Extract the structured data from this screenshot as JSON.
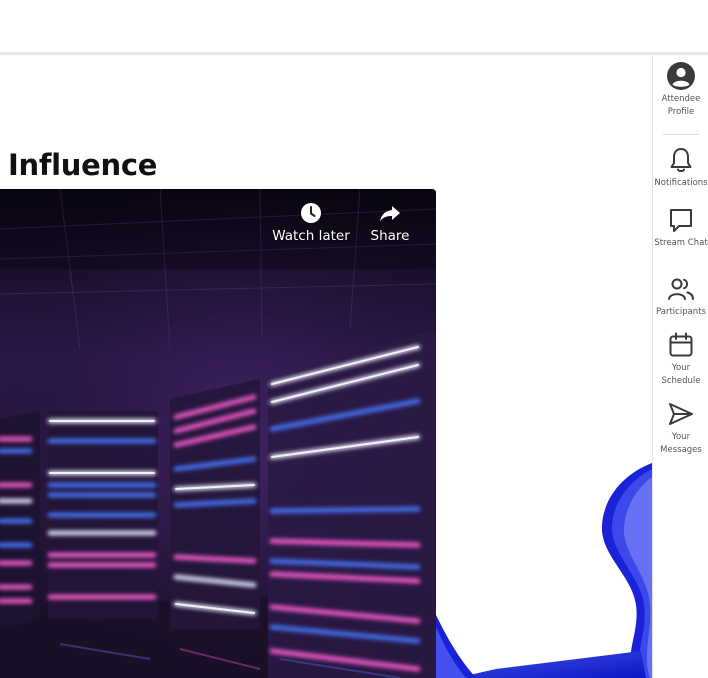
{
  "page": {
    "title": "Influence"
  },
  "video": {
    "watch_later_label": "Watch later",
    "share_label": "Share",
    "icons": {
      "watch_later": "clock-icon",
      "share": "share-arrow-icon"
    }
  },
  "sidebar": {
    "items": [
      {
        "label": "Attendee Profile",
        "icon": "user-circle-icon"
      },
      {
        "label": "Notifications",
        "icon": "bell-icon"
      },
      {
        "label": "Stream Chat",
        "icon": "chat-bubble-icon"
      },
      {
        "label": "Participants",
        "icon": "users-icon"
      },
      {
        "label": "Your Schedule",
        "icon": "calendar-icon"
      },
      {
        "label": "Your Messages",
        "icon": "send-icon"
      }
    ]
  },
  "colors": {
    "accent_blue": "#1f2fd6",
    "icon_gray": "#3a3a3a",
    "neon_pink": "#ff5fd2",
    "neon_blue": "#4a78ff",
    "neon_white": "#e8eaff"
  }
}
